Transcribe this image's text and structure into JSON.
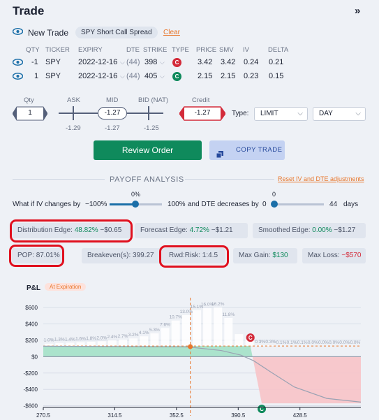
{
  "header": {
    "title": "Trade",
    "collapse_icon": "»"
  },
  "new_trade": {
    "label": "New Trade",
    "strategy": "SPY Short Call Spread",
    "clear": "Clear"
  },
  "legs": {
    "headers": [
      "QTY",
      "TICKER",
      "EXPIRY",
      "DTE",
      "STRIKE",
      "TYPE",
      "PRICE",
      "SMV",
      "IV",
      "DELTA"
    ],
    "rows": [
      {
        "qty": "-1",
        "ticker": "SPY",
        "expiry": "2022-12-16",
        "dte": "(44)",
        "strike": "398",
        "type": "C",
        "type_color": "#d32b3a",
        "price": "3.42",
        "smv": "3.42",
        "iv": "0.24",
        "delta": "0.21"
      },
      {
        "qty": "1",
        "ticker": "SPY",
        "expiry": "2022-12-16",
        "dte": "(44)",
        "strike": "405",
        "type": "C",
        "type_color": "#0f8a5c",
        "price": "2.15",
        "smv": "2.15",
        "iv": "0.23",
        "delta": "0.15"
      }
    ]
  },
  "order": {
    "qty_label": "Qty",
    "qty": "1",
    "ask_label": "ASK",
    "mid_label": "MID",
    "bid_label": "BID (NAT)",
    "mid_value": "-1.27",
    "ask_value": "-1.29",
    "mid_sub": "-1.27",
    "bid_value": "-1.25",
    "credit_label": "Credit",
    "credit_value": "-1.27",
    "type_label": "Type:",
    "order_type": "LIMIT",
    "duration": "DAY"
  },
  "buttons": {
    "review": "Review Order",
    "copy": "COPY TRADE"
  },
  "payoff": {
    "title": "PAYOFF ANALYSIS",
    "reset": "Reset IV and DTE adjustments",
    "iv_text": "What if IV changes by",
    "iv_min": "−100%",
    "iv_value": "0%",
    "iv_max": "100%",
    "dte_text": "and DTE decreases by",
    "dte_min": "0",
    "dte_value": "0",
    "dte_max": "44",
    "dte_unit": "days"
  },
  "stats": {
    "distribution_edge": {
      "label": "Distribution Edge:",
      "pct": "48.82%",
      "amt": "−$0.65"
    },
    "forecast_edge": {
      "label": "Forecast Edge:",
      "pct": "4.72%",
      "amt": "−$1.21"
    },
    "smoothed_edge": {
      "label": "Smoothed Edge:",
      "pct": "0.00%",
      "amt": "−$1.27"
    },
    "pop": {
      "label": "POP:",
      "value": "87.01%"
    },
    "breakeven": {
      "label": "Breakeven(s):",
      "value": "399.27"
    },
    "rwd_risk": {
      "label": "Rwd:Risk:",
      "value": "1:4.5"
    },
    "max_gain": {
      "label": "Max Gain:",
      "value": "$130"
    },
    "max_loss": {
      "label": "Max Loss:",
      "value": "−$570"
    }
  },
  "chart_data": {
    "type": "area",
    "title": "P&L",
    "badge": "At Expiration",
    "ylabel": "P&L",
    "ylim": [
      -620,
      720
    ],
    "xlim": [
      270.5,
      466
    ],
    "y_ticks": [
      "$600",
      "$400",
      "$200",
      "$0",
      "-$200",
      "-$400",
      "-$600"
    ],
    "y_tick_values": [
      600,
      400,
      200,
      0,
      -200,
      -400,
      -600
    ],
    "x_ticks": [
      "270.5",
      "314.5",
      "352.5",
      "390.5",
      "428.5"
    ],
    "x_tick_values": [
      270.5,
      314.5,
      352.5,
      390.5,
      428.5
    ],
    "payoff": [
      {
        "x": 270.5,
        "y": 130
      },
      {
        "x": 398,
        "y": 130
      },
      {
        "x": 405,
        "y": -570
      },
      {
        "x": 466,
        "y": -570
      }
    ],
    "theoretical": [
      {
        "x": 270.5,
        "y": 128
      },
      {
        "x": 360,
        "y": 118
      },
      {
        "x": 380,
        "y": 75
      },
      {
        "x": 392,
        "y": 20
      },
      {
        "x": 400,
        "y": -50
      },
      {
        "x": 410,
        "y": -180
      },
      {
        "x": 425,
        "y": -370
      },
      {
        "x": 445,
        "y": -510
      },
      {
        "x": 466,
        "y": -555
      }
    ],
    "current_price": 361,
    "current_pnl": 122,
    "distribution": {
      "x": [
        274,
        280.5,
        287,
        293.5,
        300,
        306.5,
        313,
        319.5,
        326,
        332.5,
        339,
        345.5,
        352,
        358.5,
        365,
        371.5,
        378,
        384.5,
        391,
        397.5,
        404,
        410.5,
        417,
        423.5,
        430,
        436.5,
        443,
        449.5,
        456,
        462.5
      ],
      "values": [
        1.0,
        1.3,
        1.4,
        1.6,
        1.8,
        2.0,
        2.4,
        2.7,
        3.2,
        4.1,
        5.3,
        7.6,
        10.7,
        13.0,
        15.1,
        16.0,
        16.2,
        11.8,
        5.0,
        3.0,
        0.3,
        0.3,
        0.1,
        0.1,
        0.1,
        0.0,
        0.0,
        0.0,
        0.0,
        0.0
      ],
      "labels": [
        "1.0%",
        "1.3%",
        "1.4%",
        "1.6%",
        "1.8%",
        "2.0%",
        "2.4%",
        "2.7%",
        "3.2%",
        "4.1%",
        "5.3%",
        "7.6%",
        "10.7%",
        "13.0%",
        "15.1%",
        "16.0%",
        "16.2%",
        "11.8%",
        "",
        "",
        "0.3%",
        "0.3%",
        "0.1%",
        "0.1%",
        "0.1%",
        "0.0%",
        "0.0%",
        "0.0%",
        "0.0%",
        "0.0%"
      ]
    },
    "strike_markers": [
      {
        "x": 398,
        "label": "C",
        "color": "#d32b3a",
        "pnl": 130
      },
      {
        "x": 405,
        "label": "C",
        "color": "#0f8a5c",
        "pnl": -570
      }
    ]
  }
}
